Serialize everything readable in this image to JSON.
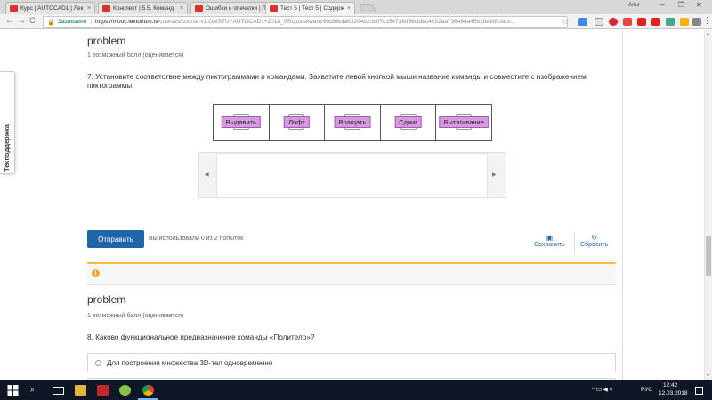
{
  "browser": {
    "tabs": [
      {
        "label": "Курс | AUTOCAD1 | Лек"
      },
      {
        "label": "Конспект | 5.5. Команд"
      },
      {
        "label": "Ошибки и опечатки | Л"
      },
      {
        "label": "Тест 5 | Тест 5 | Содерж"
      }
    ],
    "user_name": "Artur",
    "back": "←",
    "forward": "→",
    "reload": "C",
    "secure_label": "Защищено",
    "url_host": "https://mooc.lektorium.tv",
    "url_path": "/courses/course-v1:OMSTU+AUTOCAD1+2018_05/courseware/69d98dfa63204b20b07c154738d56cb8/c4032aa736484a45b28e9bfcfacc..."
  },
  "sidebar": {
    "support_label": "Техподдержка"
  },
  "problem1": {
    "title": "problem",
    "points": "1 возможный балл (оценивается)",
    "question": "7. Установите соответствие между пиктограммами и командами. Захватите левой кнопкой мыши название команды и совместите с изображением пиктограммы:",
    "commands": [
      "Выдавить",
      "Лофт",
      "Вращать",
      "Сдвиг",
      "Вытягивание"
    ],
    "submit_label": "Отправить",
    "attempts": "Вы использовали 0 из 2 попыток",
    "save_label": "Сохранить",
    "reset_label": "Сбросить",
    "warning_icon": "!"
  },
  "problem2": {
    "title": "problem",
    "points": "1 возможный балл (оценивается)",
    "question": "8. Каково функциональное предназначение команды «Политело»?",
    "options": [
      "Для построения множества 3D-тел одновременно"
    ]
  },
  "taskbar": {
    "language": "РУС",
    "time": "12:42",
    "date": "12.03.2018"
  },
  "colors": {
    "accent": "#1e66a8",
    "drag_item": "#d79ae0",
    "warning": "#fdbc3f",
    "taskbar": "#0f1727"
  }
}
